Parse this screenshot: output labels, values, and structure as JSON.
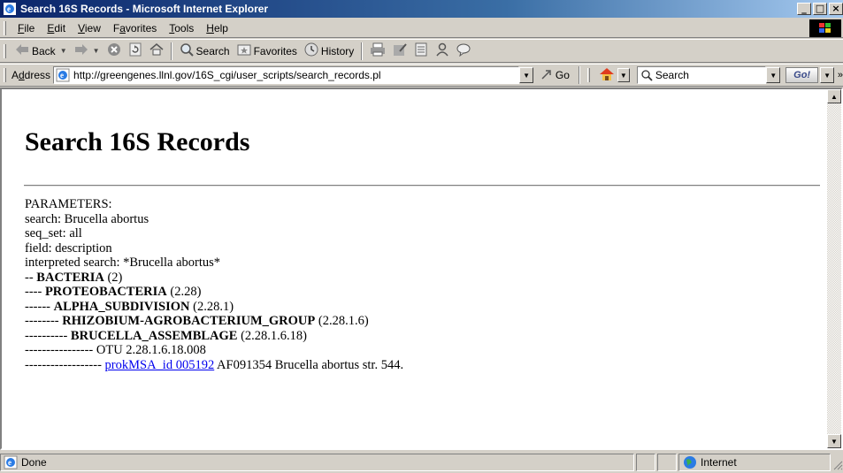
{
  "window": {
    "title": "Search 16S Records - Microsoft Internet Explorer",
    "buttons": [
      "_",
      "□",
      "×"
    ]
  },
  "menubar": {
    "items": [
      {
        "label": "File",
        "accel": "F",
        "rest": "ile"
      },
      {
        "label": "Edit",
        "accel": "E",
        "rest": "dit"
      },
      {
        "label": "View",
        "accel": "V",
        "rest": "iew"
      },
      {
        "label": "Favorites",
        "accel_prefix": "F",
        "accel": "a",
        "rest": "vorites"
      },
      {
        "label": "Tools",
        "accel": "T",
        "rest": "ools"
      },
      {
        "label": "Help",
        "accel": "H",
        "rest": "elp"
      }
    ]
  },
  "toolbar": {
    "back": "Back",
    "search": "Search",
    "favorites": "Favorites",
    "history": "History"
  },
  "addressbar": {
    "label_prefix": "A",
    "label_accel": "d",
    "label_rest": "dress",
    "url": "http://greengenes.llnl.gov/16S_cgi/user_scripts/search_records.pl",
    "go": "Go",
    "search_placeholder": "Search",
    "gobang": "Go!"
  },
  "page": {
    "heading": "Search 16S Records",
    "lines": [
      {
        "pre": "PARAMETERS:"
      },
      {
        "pre": "search: Brucella abortus"
      },
      {
        "pre": "seq_set: all"
      },
      {
        "pre": "field: description"
      },
      {
        "pre": "interpreted search: *Brucella abortus*"
      },
      {
        "pre": "-- ",
        "bold": "BACTERIA",
        "post": " (2)"
      },
      {
        "pre": "---- ",
        "bold": "PROTEOBACTERIA",
        "post": " (2.28)"
      },
      {
        "pre": "------ ",
        "bold": "ALPHA_SUBDIVISION",
        "post": " (2.28.1)"
      },
      {
        "pre": "-------- ",
        "bold": "RHIZOBIUM-AGROBACTERIUM_GROUP",
        "post": " (2.28.1.6)"
      },
      {
        "pre": "---------- ",
        "bold": "BRUCELLA_ASSEMBLAGE",
        "post": " (2.28.1.6.18)"
      },
      {
        "pre": "---------------- OTU 2.28.1.6.18.008"
      },
      {
        "pre": "------------------ ",
        "link": "prokMSA_id 005192",
        "post": " AF091354 Brucella abortus str. 544."
      }
    ]
  },
  "statusbar": {
    "status": "Done",
    "zone": "Internet"
  }
}
